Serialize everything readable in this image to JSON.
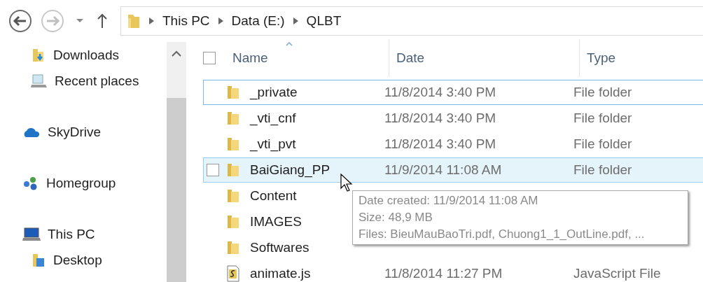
{
  "nav": {
    "breadcrumb": [
      "This PC",
      "Data (E:)",
      "QLBT"
    ]
  },
  "sidebar": {
    "partial_group": [
      {
        "label": "Downloads",
        "kind": "downloads"
      },
      {
        "label": "Recent places",
        "kind": "recent"
      }
    ],
    "items": [
      {
        "label": "SkyDrive",
        "kind": "cloud"
      },
      {
        "label": "Homegroup",
        "kind": "homegroup"
      },
      {
        "label": "This PC",
        "kind": "pc",
        "children": [
          {
            "label": "Desktop",
            "kind": "desktop"
          }
        ]
      }
    ]
  },
  "table": {
    "select_all": {
      "checked": false
    },
    "columns": [
      {
        "label": "Name",
        "sorted": true
      },
      {
        "label": "Date",
        "sorted": false
      },
      {
        "label": "Type",
        "sorted": false
      }
    ],
    "rows": [
      {
        "name": "_private",
        "kind": "folder",
        "date": "11/8/2014 3:40 PM",
        "type": "File folder",
        "focused": true,
        "hovered": false
      },
      {
        "name": "_vti_cnf",
        "kind": "folder",
        "date": "11/8/2014 3:40 PM",
        "type": "File folder",
        "focused": false,
        "hovered": false
      },
      {
        "name": "_vti_pvt",
        "kind": "folder",
        "date": "11/8/2014 3:40 PM",
        "type": "File folder",
        "focused": false,
        "hovered": false
      },
      {
        "name": "BaiGiang_PP",
        "kind": "folder",
        "date": "11/9/2014 11:08 AM",
        "type": "File folder",
        "focused": false,
        "hovered": true
      },
      {
        "name": "Content",
        "kind": "folder",
        "focused": false,
        "hovered": false
      },
      {
        "name": "IMAGES",
        "kind": "folder",
        "focused": false,
        "hovered": false
      },
      {
        "name": "Softwares",
        "kind": "folder",
        "focused": false,
        "hovered": false
      },
      {
        "name": "animate.js",
        "kind": "script",
        "date": "11/8/2014 11:27 PM",
        "type": "JavaScript File",
        "focused": false,
        "hovered": false
      }
    ]
  },
  "tooltip": {
    "lines": [
      "Date created: 11/9/2014 11:08 AM",
      "Size: 48,9 MB",
      "Files: BieuMauBaoTri.pdf, Chuong1_1_OutLine.pdf, ..."
    ]
  }
}
